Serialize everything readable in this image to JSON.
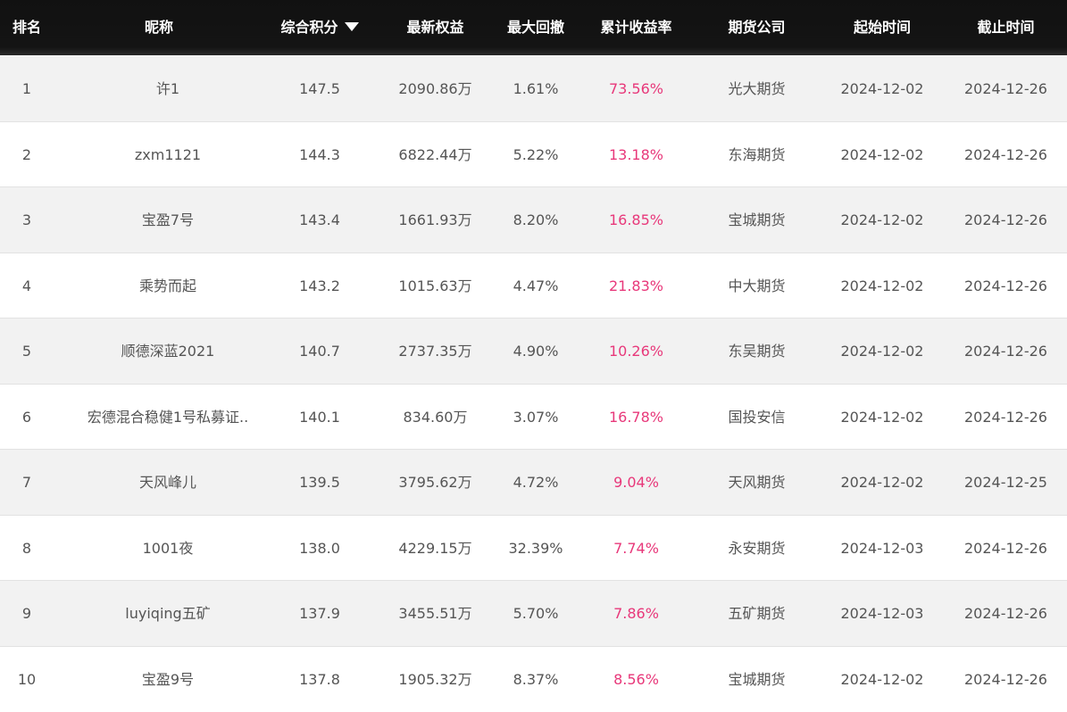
{
  "table": {
    "headers": {
      "rank": "排名",
      "nickname": "昵称",
      "score": "综合积分",
      "equity": "最新权益",
      "drawdown": "最大回撤",
      "return": "累计收益率",
      "company": "期货公司",
      "start": "起始时间",
      "end": "截止时间"
    },
    "sort_icon": "sort-down-triangle-icon",
    "return_color": "#e8387a",
    "rows": [
      {
        "rank": "1",
        "nickname": "许1",
        "score": "147.5",
        "equity": "2090.86万",
        "drawdown": "1.61%",
        "return": "73.56%",
        "company": "光大期货",
        "start": "2024-12-02",
        "end": "2024-12-26"
      },
      {
        "rank": "2",
        "nickname": "zxm1121",
        "score": "144.3",
        "equity": "6822.44万",
        "drawdown": "5.22%",
        "return": "13.18%",
        "company": "东海期货",
        "start": "2024-12-02",
        "end": "2024-12-26"
      },
      {
        "rank": "3",
        "nickname": "宝盈7号",
        "score": "143.4",
        "equity": "1661.93万",
        "drawdown": "8.20%",
        "return": "16.85%",
        "company": "宝城期货",
        "start": "2024-12-02",
        "end": "2024-12-26"
      },
      {
        "rank": "4",
        "nickname": "乘势而起",
        "score": "143.2",
        "equity": "1015.63万",
        "drawdown": "4.47%",
        "return": "21.83%",
        "company": "中大期货",
        "start": "2024-12-02",
        "end": "2024-12-26"
      },
      {
        "rank": "5",
        "nickname": "顺德深蓝2021",
        "score": "140.7",
        "equity": "2737.35万",
        "drawdown": "4.90%",
        "return": "10.26%",
        "company": "东吴期货",
        "start": "2024-12-02",
        "end": "2024-12-26"
      },
      {
        "rank": "6",
        "nickname": "宏德混合稳健1号私募证..",
        "score": "140.1",
        "equity": "834.60万",
        "drawdown": "3.07%",
        "return": "16.78%",
        "company": "国投安信",
        "start": "2024-12-02",
        "end": "2024-12-26"
      },
      {
        "rank": "7",
        "nickname": "天风峰儿",
        "score": "139.5",
        "equity": "3795.62万",
        "drawdown": "4.72%",
        "return": "9.04%",
        "company": "天风期货",
        "start": "2024-12-02",
        "end": "2024-12-25"
      },
      {
        "rank": "8",
        "nickname": "1001夜",
        "score": "138.0",
        "equity": "4229.15万",
        "drawdown": "32.39%",
        "return": "7.74%",
        "company": "永安期货",
        "start": "2024-12-03",
        "end": "2024-12-26"
      },
      {
        "rank": "9",
        "nickname": "luyiqing五矿",
        "score": "137.9",
        "equity": "3455.51万",
        "drawdown": "5.70%",
        "return": "7.86%",
        "company": "五矿期货",
        "start": "2024-12-03",
        "end": "2024-12-26"
      },
      {
        "rank": "10",
        "nickname": "宝盈9号",
        "score": "137.8",
        "equity": "1905.32万",
        "drawdown": "8.37%",
        "return": "8.56%",
        "company": "宝城期货",
        "start": "2024-12-02",
        "end": "2024-12-26"
      }
    ]
  }
}
